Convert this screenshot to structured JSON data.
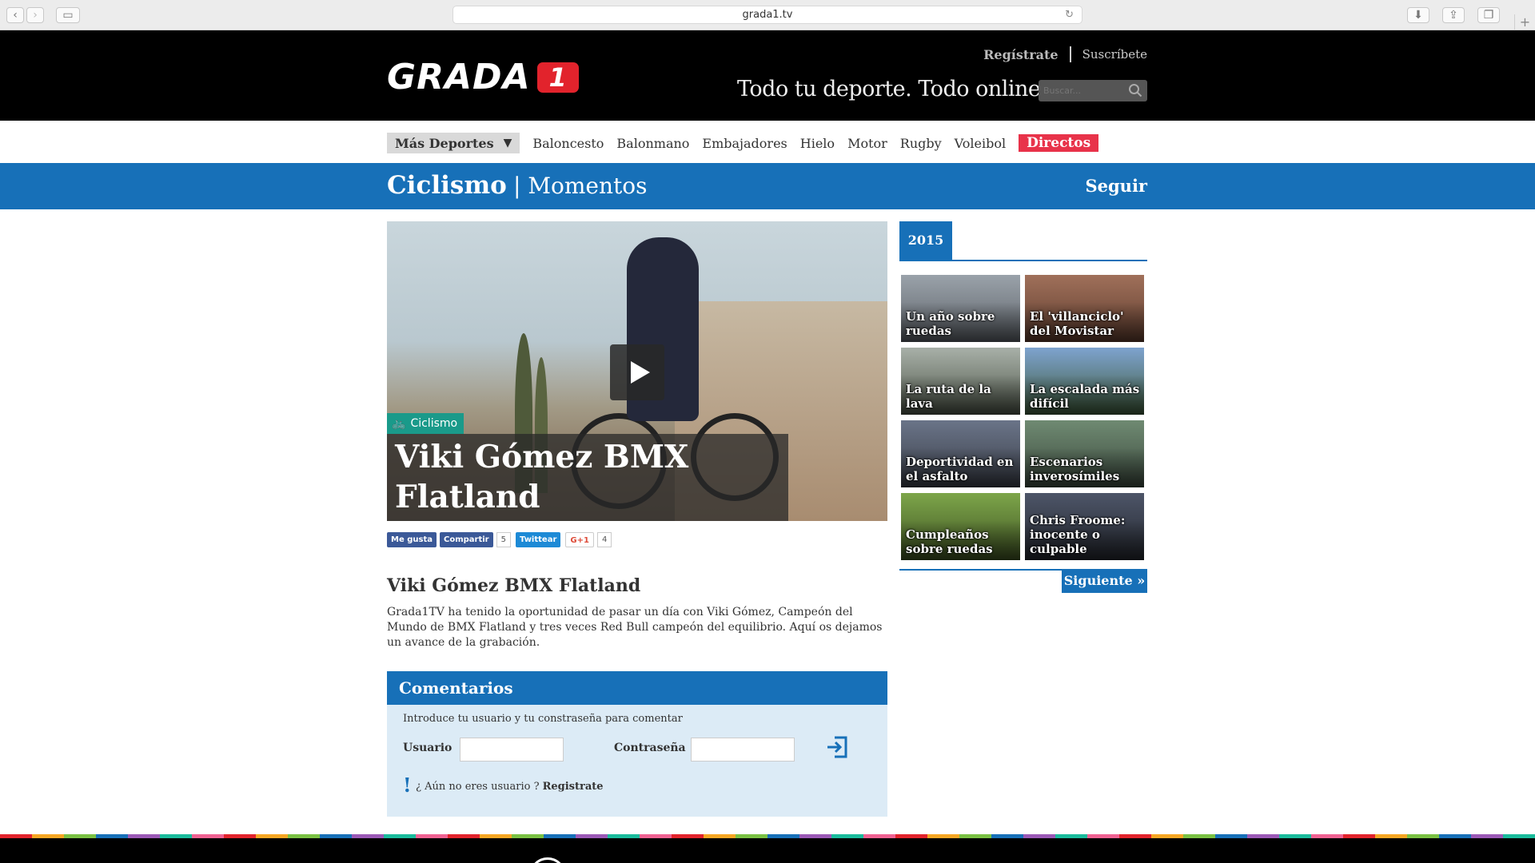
{
  "browser": {
    "url": "grada1.tv"
  },
  "header": {
    "logo_text": "GRADA",
    "logo_badge": "1",
    "register": "Regístrate",
    "subscribe": "Suscríbete",
    "tagline": "Todo tu deporte. Todo online.",
    "search_placeholder": "Buscar..."
  },
  "nav": {
    "more": "Más Deportes",
    "items": [
      "Baloncesto",
      "Balonmano",
      "Embajadores",
      "Hielo",
      "Motor",
      "Rugby",
      "Voleibol"
    ],
    "live": "Directos"
  },
  "section": {
    "title": "Ciclismo",
    "subtitle": "| Momentos",
    "follow": "Seguir"
  },
  "video": {
    "tag": "Ciclismo",
    "title": "Viki Gómez BMX Flatland"
  },
  "social": {
    "like": "Me gusta",
    "share": "Compartir",
    "share_count": "5",
    "tweet": "Twittear",
    "gplus": "G+1",
    "gplus_count": "4"
  },
  "article": {
    "title": "Viki Gómez BMX Flatland",
    "body": "Grada1TV ha tenido la oportunidad de pasar un día con Viki Gómez, Campeón del Mundo de BMX Flatland y tres veces Red Bull campeón del equilibrio. Aquí os dejamos un avance de la grabación."
  },
  "comments": {
    "heading": "Comentarios",
    "intro": "Introduce tu usuario y tu constraseña para comentar",
    "user_label": "Usuario",
    "password_label": "Contraseña",
    "exclamation": "!",
    "no_user": "¿ Aún no eres usuario ?",
    "register": "Registrate"
  },
  "sidebar": {
    "year": "2015",
    "thumbs": [
      {
        "caption": "Un año sobre ruedas",
        "color": "#7a7f86"
      },
      {
        "caption": "El 'villanciclo' del Movistar",
        "color": "#8a5a45"
      },
      {
        "caption": "La ruta de la lava",
        "color": "#6e7c6a"
      },
      {
        "caption": "La escalada más difícil",
        "color": "#5b7fa8"
      },
      {
        "caption": "Deportividad en el asfalto",
        "color": "#4a5060"
      },
      {
        "caption": "Escenarios inverosímiles",
        "color": "#586a5c"
      },
      {
        "caption": "Cumpleaños sobre ruedas",
        "color": "#5f7a3a"
      },
      {
        "caption": "Chris Froome: inocente o culpable",
        "color": "#3a3f4a"
      }
    ],
    "next": "Siguiente »"
  }
}
